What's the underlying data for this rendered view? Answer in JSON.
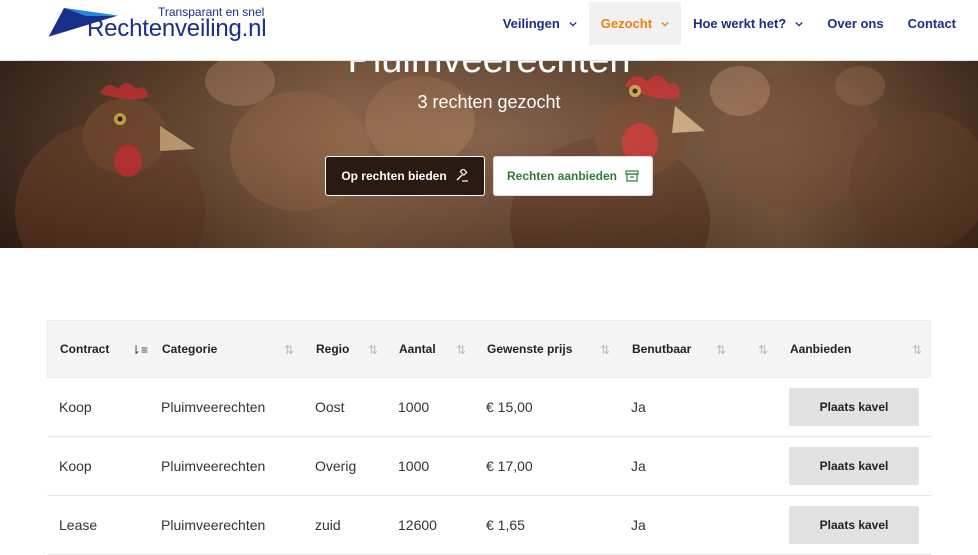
{
  "logo": {
    "tagline": "Transparant en snel",
    "brand": "Rechtenveiling.nl"
  },
  "nav": {
    "items": [
      {
        "label": "Veilingen",
        "dropdown": true
      },
      {
        "label": "Gezocht",
        "dropdown": true,
        "active": true
      },
      {
        "label": "Hoe werkt het?",
        "dropdown": true
      },
      {
        "label": "Over ons",
        "dropdown": false
      },
      {
        "label": "Contact",
        "dropdown": false
      }
    ]
  },
  "hero": {
    "title": "Pluimveerechten",
    "subtitle": "3 rechten gezocht",
    "bid_button": "Op rechten bieden",
    "offer_button": "Rechten aanbieden"
  },
  "table": {
    "headers": [
      "Contract",
      "Categorie",
      "Regio",
      "Aantal",
      "Gewenste prijs",
      "Benutbaar",
      "",
      "Aanbieden"
    ],
    "rows": [
      {
        "contract": "Koop",
        "categorie": "Pluimveerechten",
        "regio": "Oost",
        "aantal": "1000",
        "prijs": "€ 15,00",
        "benutbaar": "Ja",
        "action": "Plaats kavel"
      },
      {
        "contract": "Koop",
        "categorie": "Pluimveerechten",
        "regio": "Overig",
        "aantal": "1000",
        "prijs": "€ 17,00",
        "benutbaar": "Ja",
        "action": "Plaats kavel"
      },
      {
        "contract": "Lease",
        "categorie": "Pluimveerechten",
        "regio": "zuid",
        "aantal": "12600",
        "prijs": "€ 1,65",
        "benutbaar": "Ja",
        "action": "Plaats kavel"
      }
    ]
  },
  "colors": {
    "brand_blue": "#1a2f8a",
    "active_orange": "#e8820c",
    "offer_green": "#2e7d32"
  }
}
